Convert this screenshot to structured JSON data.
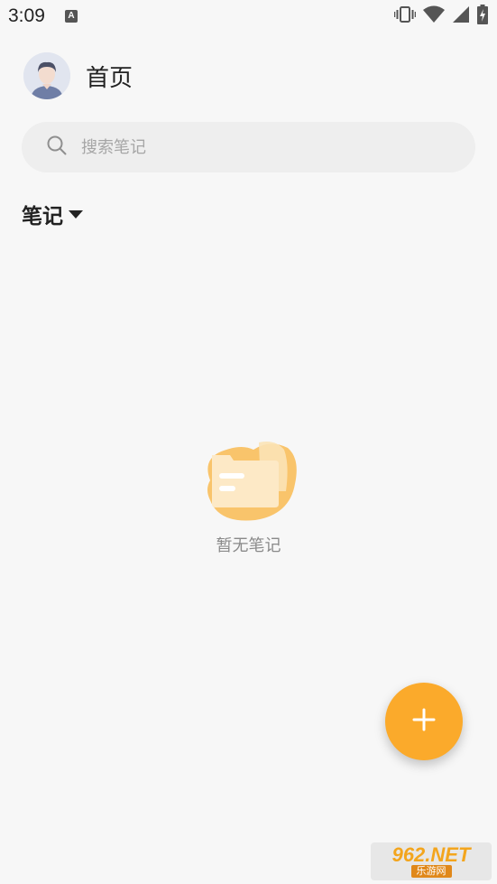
{
  "status_bar": {
    "time": "3:09",
    "notification_icon": "a-letter-icon",
    "notification_letter": "A",
    "icons": [
      "vibrate-icon",
      "wifi-icon",
      "signal-icon",
      "battery-charging-icon"
    ]
  },
  "header": {
    "avatar_icon": "user-avatar-icon",
    "title": "首页"
  },
  "search": {
    "placeholder": "搜索笔记",
    "value": "",
    "icon": "search-icon"
  },
  "category": {
    "label": "笔记",
    "icon": "caret-down-icon"
  },
  "empty_state": {
    "illustration": "empty-folder-icon",
    "text": "暂无笔记"
  },
  "fab": {
    "icon": "plus-icon"
  },
  "watermark": {
    "top": "962.NET",
    "bottom": "乐游网"
  },
  "colors": {
    "background": "#f7f7f7",
    "accent": "#fbaa2b",
    "search_bg": "#eeeeee",
    "placeholder": "#a6a6a6",
    "empty_text": "#8a8a8a"
  }
}
